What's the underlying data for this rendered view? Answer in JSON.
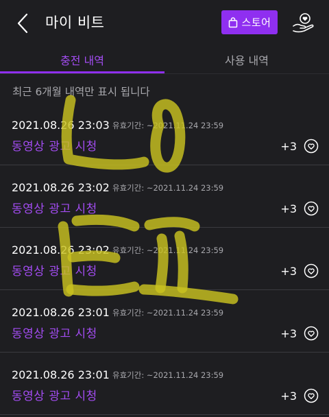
{
  "header": {
    "title": "마이 비트",
    "store_label": "스토어"
  },
  "tabs": [
    {
      "label": "충전 내역",
      "active": true
    },
    {
      "label": "사용 내역",
      "active": false
    }
  ],
  "notice": "최근 6개월 내역만 표시 됩니다",
  "items": [
    {
      "date": "2021.08.26 23:03",
      "expiry": "유효기간: ~2021.11.24 23:59",
      "label": "동영상 광고 시청",
      "amount": "+3"
    },
    {
      "date": "2021.08.26 23:02",
      "expiry": "유효기간: ~2021.11.24 23:59",
      "label": "동영상 광고 시청",
      "amount": "+3"
    },
    {
      "date": "2021.08.26 23:02",
      "expiry": "유효기간: ~2021.11.24 23:59",
      "label": "동영상 광고 시청",
      "amount": "+3"
    },
    {
      "date": "2021.08.26 23:01",
      "expiry": "유효기간: ~2021.11.24 23:59",
      "label": "동영상 광고 시청",
      "amount": "+3"
    },
    {
      "date": "2021.08.26 23:01",
      "expiry": "유효기간: ~2021.11.24 23:59",
      "label": "동영상 광고 시청",
      "amount": "+3"
    }
  ],
  "icons": {
    "back": "chevron-left-icon",
    "store": "shopping-bag-icon",
    "profile": "hand-heart-icon",
    "item": "heart-circle-icon"
  },
  "colors": {
    "background": "#1e1e21",
    "accent": "#8f2ff0",
    "accent_text": "#a34cf2",
    "secondary_text": "#a8a8ad",
    "scribble": "#c9c220"
  }
}
